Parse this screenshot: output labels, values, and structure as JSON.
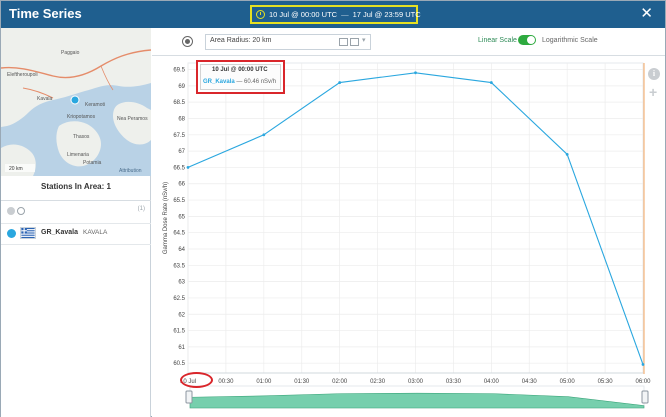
{
  "window": {
    "title": "Time Series",
    "date_range": {
      "start": "10 Jul @ 00:00 UTC",
      "separator": "—",
      "end": "17 Jul @ 23:59 UTC"
    },
    "close_label": "✕"
  },
  "map": {
    "labels": [
      "Kavala",
      "Keramoti",
      "Thasos",
      "Kriopotamos",
      "Nea Peramos",
      "Eleftheroupoli",
      "Paggaio",
      "Limenaria",
      "Potamia"
    ],
    "scale_label": "20 km",
    "attribution": "Attribution",
    "colors": {
      "sea": "#b9d2e6",
      "land": "#eef0ec",
      "road": "#e58c6a"
    }
  },
  "stations": {
    "title": "Stations In Area: 1",
    "count_label": "(1)",
    "items": [
      {
        "name": "GR_Kavala",
        "city": "KAVALA",
        "dot_color": "#2aa7df"
      }
    ]
  },
  "toolbar": {
    "area_radius": "Area Radius: 20 km",
    "linear_label": "Linear Scale",
    "log_label": "Logarithmic Scale",
    "scale_mode": "linear"
  },
  "tooltip": {
    "header": "10 Jul @ 00:00 UTC",
    "series": "GR_Kavala",
    "separator": "—",
    "value": "60.46",
    "unit": "nSv/h"
  },
  "chart_data": {
    "type": "line",
    "ylabel": "Gamma Dose Rate (nSv/h)",
    "x": [
      "10 Jul",
      "00:30",
      "01:00",
      "01:30",
      "02:00",
      "02:30",
      "03:00",
      "03:30",
      "04:00",
      "04:30",
      "05:00",
      "05:30",
      "06:00"
    ],
    "series": [
      {
        "name": "GR_Kavala",
        "color": "#2aa7df",
        "points": [
          {
            "x": "00:00",
            "y": 66.5
          },
          {
            "x": "01:00",
            "y": 67.5
          },
          {
            "x": "02:00",
            "y": 69.1
          },
          {
            "x": "03:00",
            "y": 69.4
          },
          {
            "x": "04:00",
            "y": 69.1
          },
          {
            "x": "05:00",
            "y": 66.9
          },
          {
            "x": "06:00",
            "y": 60.46
          }
        ]
      }
    ],
    "yticks": [
      60.5,
      61,
      61.5,
      62,
      62.5,
      63,
      63.5,
      64,
      64.5,
      65,
      65.5,
      66,
      66.5,
      67,
      67.5,
      68,
      68.5,
      69,
      69.5
    ],
    "ylim": [
      60.2,
      69.7
    ],
    "grid": true,
    "navigator_color": "#5ec79f"
  }
}
